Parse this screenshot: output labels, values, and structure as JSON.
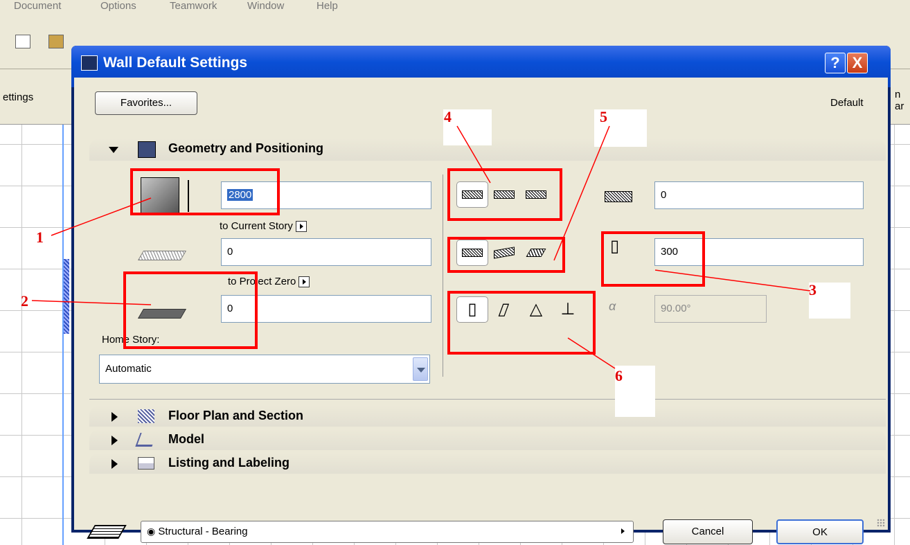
{
  "app": {
    "menus": [
      "Document",
      "Options",
      "Teamwork",
      "Window",
      "Help"
    ],
    "info_left": "ettings",
    "info_right": "n ar"
  },
  "dialog": {
    "title": "Wall Default Settings",
    "help_label": "?",
    "close_label": "X",
    "favorites_label": "Favorites...",
    "default_label": "Default",
    "panels": {
      "geometry": "Geometry and Positioning",
      "floor_plan": "Floor Plan and Section",
      "model": "Model",
      "listing": "Listing and Labeling"
    },
    "geometry": {
      "height_value": "2800",
      "to_current_story": "to Current Story",
      "bottom_offset_value": "0",
      "to_project_zero": "to Project Zero",
      "project_zero_value": "0",
      "home_story_label": "Home Story:",
      "home_story_value": "Automatic",
      "ref_offset_value": "0",
      "thickness_value": "300",
      "angle_value": "90.00°"
    },
    "layer_value": "Structural - Bearing",
    "cancel_label": "Cancel",
    "ok_label": "OK"
  },
  "callouts": [
    "1",
    "2",
    "3",
    "4",
    "5",
    "6"
  ],
  "colors": {
    "annotation": "#ff0000",
    "titlebar": "#0a4fd6",
    "dialog_bg": "#ece9d8"
  }
}
